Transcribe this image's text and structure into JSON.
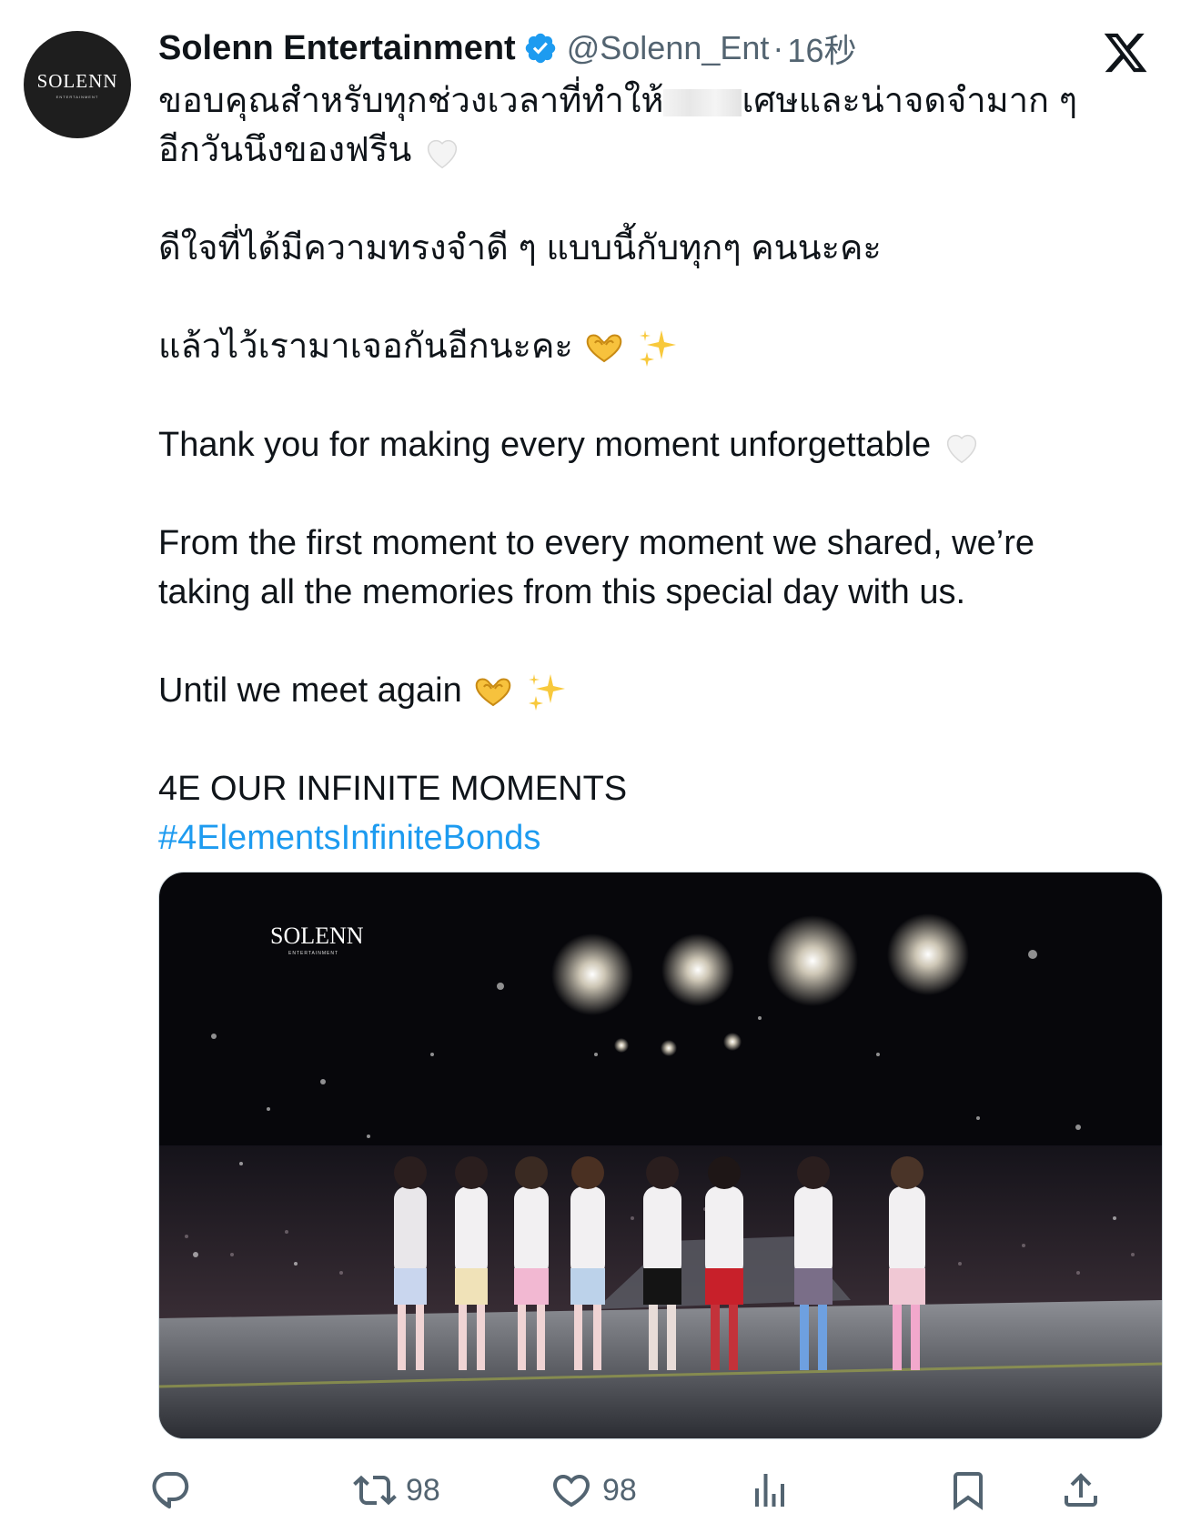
{
  "author": {
    "avatar_text": "SOLENN",
    "avatar_subtext": "ENTERTAINMENT",
    "name": "Solenn Entertainment",
    "handle": "@Solenn_Ent",
    "separator": "·",
    "time": "16秒"
  },
  "tweet": {
    "line1_before": "ขอบคุณสำหรับทุกช่วงเวลาที่ทำให้",
    "line1_after": "เศษและน่าจดจำมาก ๆ",
    "line2": "อีกวันนึงของฟรีน",
    "line3": "ดีใจที่ได้มีความทรงจำดี ๆ แบบนี้กับทุกๆ คนนะคะ",
    "line4": "แล้วไว้เรามาเจอกันอีกนะคะ",
    "line5": "Thank you for making every moment unforgettable",
    "line6": "From the first moment to every moment we shared, we’re",
    "line7": "taking all the memories from this special day with us.",
    "line8": "Until we meet again",
    "line9": "4E OUR INFINITE MOMENTS",
    "hashtag": "#4ElementsInfiniteBonds"
  },
  "media": {
    "watermark": "SOLENN",
    "watermark_sub": "ENTERTAINMENT"
  },
  "actions": {
    "reply_icon": "reply-icon",
    "retweet_count": "98",
    "like_count": "98",
    "views_icon": "views-icon",
    "bookmark_icon": "bookmark-icon",
    "share_icon": "share-icon"
  },
  "colors": {
    "text": "#0f1419",
    "secondary": "#536471",
    "link": "#1d9bf0",
    "verified": "#1d9bf0"
  }
}
